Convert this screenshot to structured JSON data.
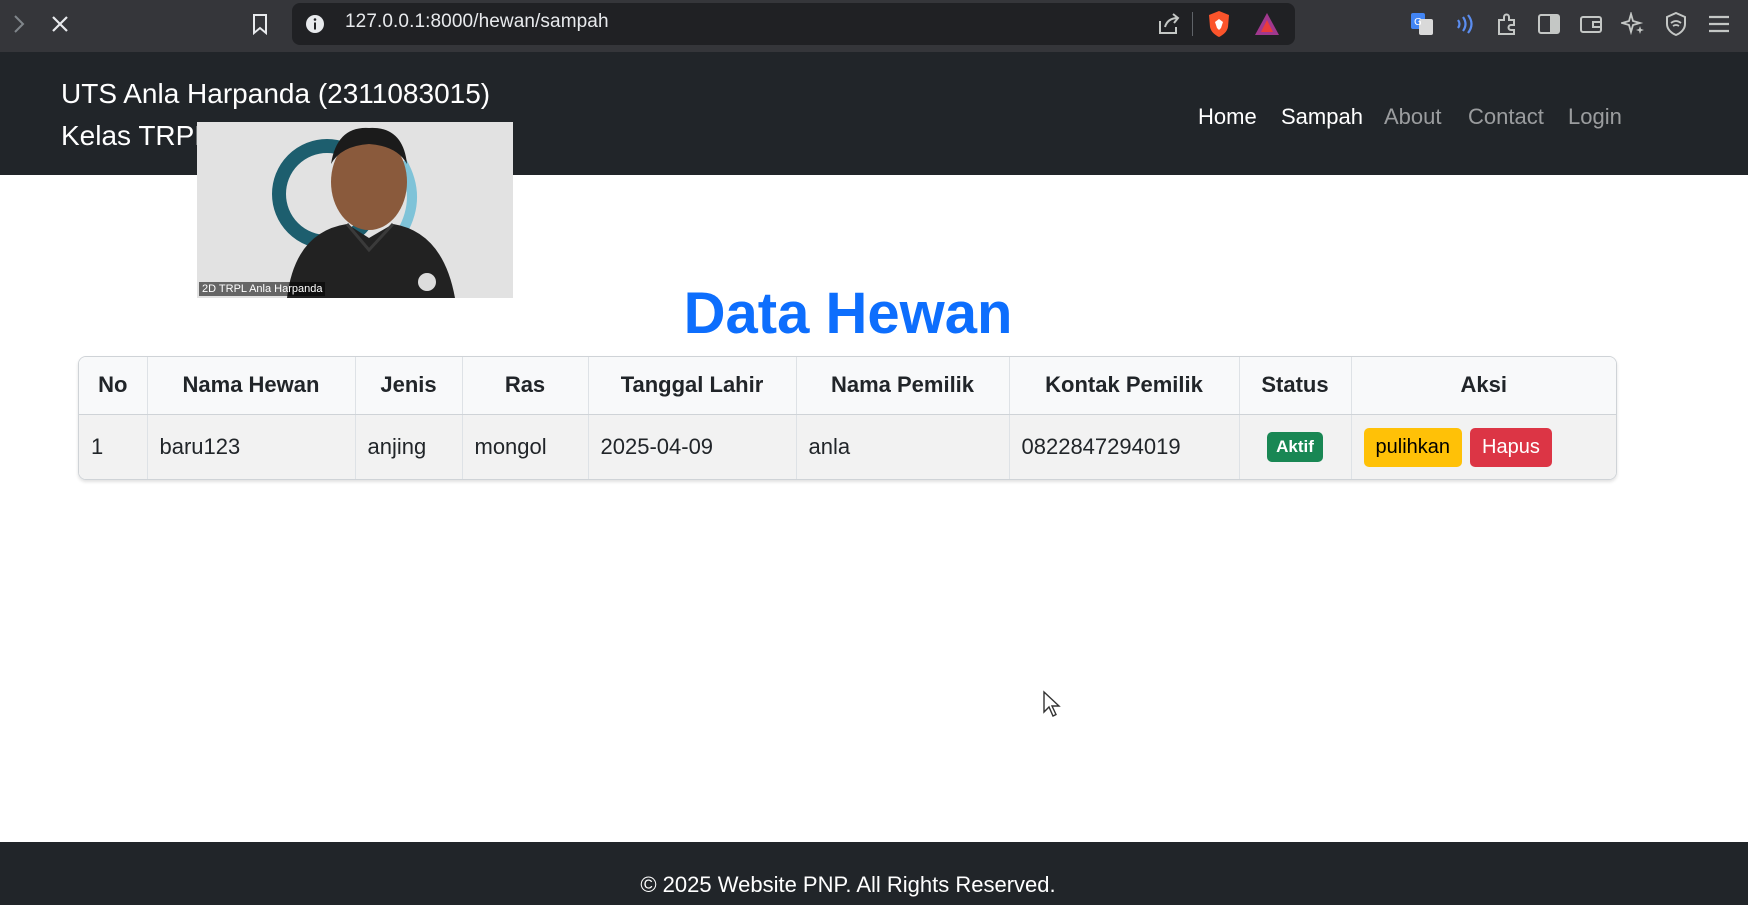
{
  "browser": {
    "url": "127.0.0.1:8000/hewan/sampah",
    "icons": [
      "forward-icon",
      "stop-loading-icon",
      "bookmark-icon",
      "site-info-icon",
      "share-icon",
      "brave-shields-icon",
      "brave-rewards-icon",
      "translate-icon",
      "speech-icon",
      "extensions-icon",
      "sidebar-icon",
      "wallet-icon",
      "leo-ai-icon",
      "vpn-icon",
      "menu-icon"
    ]
  },
  "navbar": {
    "brand_line1": "UTS Anla Harpanda (2311083015)",
    "brand_line2": "Kelas TRPL",
    "links": [
      {
        "label": "Home",
        "state": "active"
      },
      {
        "label": "Sampah",
        "state": "active"
      },
      {
        "label": "About",
        "state": "muted"
      },
      {
        "label": "Contact",
        "state": "muted"
      },
      {
        "label": "Login",
        "state": "muted"
      }
    ]
  },
  "webcam": {
    "caption": "2D TRPL Anla Harpanda"
  },
  "main": {
    "heading": "Data Hewan",
    "table": {
      "headers": [
        "No",
        "Nama Hewan",
        "Jenis",
        "Ras",
        "Tanggal Lahir",
        "Nama Pemilik",
        "Kontak Pemilik",
        "Status",
        "Aksi"
      ],
      "rows": [
        {
          "no": "1",
          "nama_hewan": "baru123",
          "jenis": "anjing",
          "ras": "mongol",
          "tanggal_lahir": "2025-04-09",
          "nama_pemilik": "anla",
          "kontak_pemilik": "0822847294019",
          "status": "Aktif",
          "actions": {
            "restore": "pulihkan",
            "delete": "Hapus"
          }
        }
      ]
    }
  },
  "footer": {
    "text": "© 2025 Website PNP. All Rights Reserved."
  },
  "colors": {
    "navbar_bg": "#212529",
    "heading": "#0d6efd",
    "badge_success": "#198754",
    "btn_warning": "#ffc107",
    "btn_danger": "#dc3545"
  }
}
